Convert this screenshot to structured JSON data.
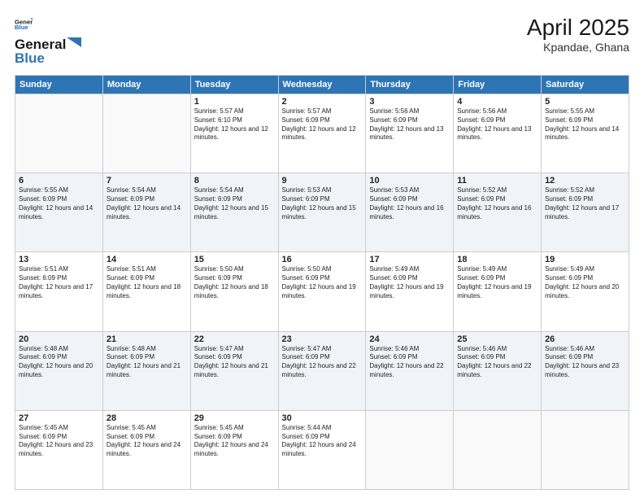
{
  "header": {
    "logo_line1": "General",
    "logo_line2": "Blue",
    "month_year": "April 2025",
    "location": "Kpandae, Ghana"
  },
  "weekdays": [
    "Sunday",
    "Monday",
    "Tuesday",
    "Wednesday",
    "Thursday",
    "Friday",
    "Saturday"
  ],
  "weeks": [
    [
      {
        "day": "",
        "info": ""
      },
      {
        "day": "",
        "info": ""
      },
      {
        "day": "1",
        "info": "Sunrise: 5:57 AM\nSunset: 6:10 PM\nDaylight: 12 hours and 12 minutes."
      },
      {
        "day": "2",
        "info": "Sunrise: 5:57 AM\nSunset: 6:09 PM\nDaylight: 12 hours and 12 minutes."
      },
      {
        "day": "3",
        "info": "Sunrise: 5:56 AM\nSunset: 6:09 PM\nDaylight: 12 hours and 13 minutes."
      },
      {
        "day": "4",
        "info": "Sunrise: 5:56 AM\nSunset: 6:09 PM\nDaylight: 12 hours and 13 minutes."
      },
      {
        "day": "5",
        "info": "Sunrise: 5:55 AM\nSunset: 6:09 PM\nDaylight: 12 hours and 14 minutes."
      }
    ],
    [
      {
        "day": "6",
        "info": "Sunrise: 5:55 AM\nSunset: 6:09 PM\nDaylight: 12 hours and 14 minutes."
      },
      {
        "day": "7",
        "info": "Sunrise: 5:54 AM\nSunset: 6:09 PM\nDaylight: 12 hours and 14 minutes."
      },
      {
        "day": "8",
        "info": "Sunrise: 5:54 AM\nSunset: 6:09 PM\nDaylight: 12 hours and 15 minutes."
      },
      {
        "day": "9",
        "info": "Sunrise: 5:53 AM\nSunset: 6:09 PM\nDaylight: 12 hours and 15 minutes."
      },
      {
        "day": "10",
        "info": "Sunrise: 5:53 AM\nSunset: 6:09 PM\nDaylight: 12 hours and 16 minutes."
      },
      {
        "day": "11",
        "info": "Sunrise: 5:52 AM\nSunset: 6:09 PM\nDaylight: 12 hours and 16 minutes."
      },
      {
        "day": "12",
        "info": "Sunrise: 5:52 AM\nSunset: 6:09 PM\nDaylight: 12 hours and 17 minutes."
      }
    ],
    [
      {
        "day": "13",
        "info": "Sunrise: 5:51 AM\nSunset: 6:09 PM\nDaylight: 12 hours and 17 minutes."
      },
      {
        "day": "14",
        "info": "Sunrise: 5:51 AM\nSunset: 6:09 PM\nDaylight: 12 hours and 18 minutes."
      },
      {
        "day": "15",
        "info": "Sunrise: 5:50 AM\nSunset: 6:09 PM\nDaylight: 12 hours and 18 minutes."
      },
      {
        "day": "16",
        "info": "Sunrise: 5:50 AM\nSunset: 6:09 PM\nDaylight: 12 hours and 19 minutes."
      },
      {
        "day": "17",
        "info": "Sunrise: 5:49 AM\nSunset: 6:09 PM\nDaylight: 12 hours and 19 minutes."
      },
      {
        "day": "18",
        "info": "Sunrise: 5:49 AM\nSunset: 6:09 PM\nDaylight: 12 hours and 19 minutes."
      },
      {
        "day": "19",
        "info": "Sunrise: 5:49 AM\nSunset: 6:09 PM\nDaylight: 12 hours and 20 minutes."
      }
    ],
    [
      {
        "day": "20",
        "info": "Sunrise: 5:48 AM\nSunset: 6:09 PM\nDaylight: 12 hours and 20 minutes."
      },
      {
        "day": "21",
        "info": "Sunrise: 5:48 AM\nSunset: 6:09 PM\nDaylight: 12 hours and 21 minutes."
      },
      {
        "day": "22",
        "info": "Sunrise: 5:47 AM\nSunset: 6:09 PM\nDaylight: 12 hours and 21 minutes."
      },
      {
        "day": "23",
        "info": "Sunrise: 5:47 AM\nSunset: 6:09 PM\nDaylight: 12 hours and 22 minutes."
      },
      {
        "day": "24",
        "info": "Sunrise: 5:46 AM\nSunset: 6:09 PM\nDaylight: 12 hours and 22 minutes."
      },
      {
        "day": "25",
        "info": "Sunrise: 5:46 AM\nSunset: 6:09 PM\nDaylight: 12 hours and 22 minutes."
      },
      {
        "day": "26",
        "info": "Sunrise: 5:46 AM\nSunset: 6:09 PM\nDaylight: 12 hours and 23 minutes."
      }
    ],
    [
      {
        "day": "27",
        "info": "Sunrise: 5:45 AM\nSunset: 6:09 PM\nDaylight: 12 hours and 23 minutes."
      },
      {
        "day": "28",
        "info": "Sunrise: 5:45 AM\nSunset: 6:09 PM\nDaylight: 12 hours and 24 minutes."
      },
      {
        "day": "29",
        "info": "Sunrise: 5:45 AM\nSunset: 6:09 PM\nDaylight: 12 hours and 24 minutes."
      },
      {
        "day": "30",
        "info": "Sunrise: 5:44 AM\nSunset: 6:09 PM\nDaylight: 12 hours and 24 minutes."
      },
      {
        "day": "",
        "info": ""
      },
      {
        "day": "",
        "info": ""
      },
      {
        "day": "",
        "info": ""
      }
    ]
  ]
}
